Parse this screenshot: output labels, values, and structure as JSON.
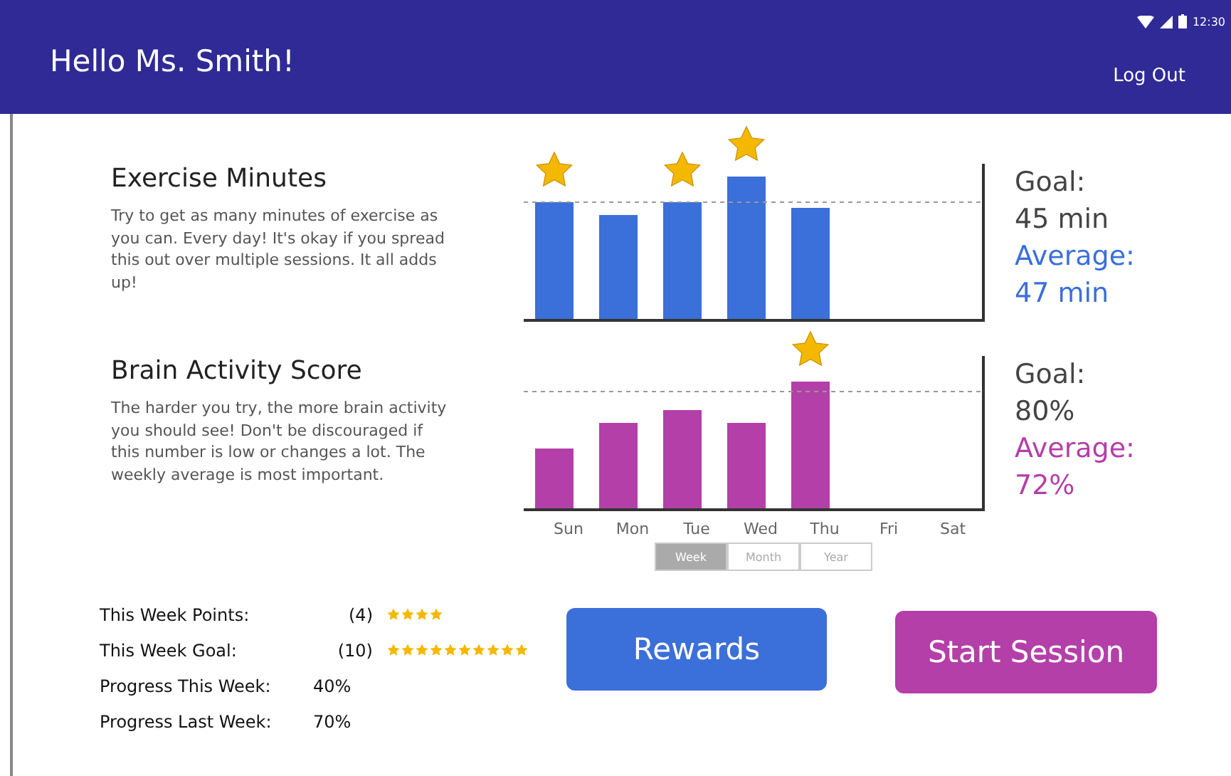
{
  "header": {
    "title": "Hello Ms. Smith!",
    "time": "12:30",
    "logout": "Log Out"
  },
  "sections": [
    {
      "kind": "exercise",
      "title": "Exercise Minutes",
      "description": "Try to get as many minutes of exercise as you can. Every day! It's okay if you spread this out over multiple sessions. It all adds up!",
      "color": "#3b6fd9",
      "goal_label": "Goal:",
      "goal_value": "45 min",
      "average_label": "Average:",
      "average_value": "47 min"
    },
    {
      "kind": "brain",
      "title": "Brain Activity Score",
      "description": "The harder you try, the more brain activity you should see! Don't be discouraged if this number is low or changes a lot. The weekly average is most important.",
      "color": "#b43fa8",
      "goal_label": "Goal:",
      "goal_value": "80%",
      "average_label": "Average:",
      "average_value": "72%"
    }
  ],
  "days": [
    "Sun",
    "Mon",
    "Tue",
    "Wed",
    "Thu",
    "Fri",
    "Sat"
  ],
  "range_tabs": [
    {
      "label": "Week",
      "selected": true
    },
    {
      "label": "Month",
      "selected": false
    },
    {
      "label": "Year",
      "selected": false
    }
  ],
  "stats": [
    {
      "label": "This Week Points:",
      "value": "(4)",
      "stars": 4
    },
    {
      "label": "This Week Goal:",
      "value": "(10)",
      "stars": 10
    },
    {
      "label": "Progress This Week:",
      "value": "40%"
    },
    {
      "label": "Progress Last Week:",
      "value": "70%"
    }
  ],
  "buttons": [
    {
      "label": "Rewards",
      "color": "#3b6fd9"
    },
    {
      "label": "Start Session",
      "color": "#b43fa8"
    }
  ]
}
